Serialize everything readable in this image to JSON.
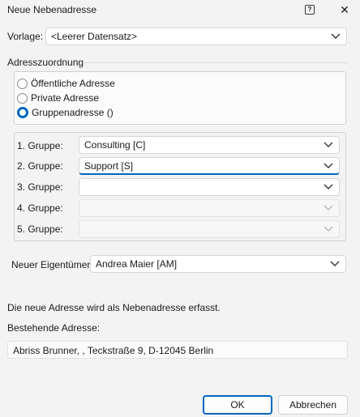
{
  "window": {
    "title": "Neue Nebenadresse",
    "help_glyph": "?",
    "close_glyph": "✕"
  },
  "template": {
    "label": "Vorlage:",
    "value": "<Leerer Datensatz>"
  },
  "assignment": {
    "title": "Adresszuordnung",
    "options": [
      {
        "label": "Öffentliche Adresse",
        "checked": false
      },
      {
        "label": "Private Adresse",
        "checked": false
      },
      {
        "label": "Gruppenadresse ()",
        "checked": true
      }
    ]
  },
  "groups": [
    {
      "label": "1. Gruppe:",
      "value": "Consulting [C]",
      "enabled": true
    },
    {
      "label": "2. Gruppe:",
      "value": "Support [S]",
      "enabled": true
    },
    {
      "label": "3. Gruppe:",
      "value": "",
      "enabled": true
    },
    {
      "label": "4. Gruppe:",
      "value": "",
      "enabled": false
    },
    {
      "label": "5. Gruppe:",
      "value": "",
      "enabled": false
    }
  ],
  "owner": {
    "label": "Neuer Eigentümer:",
    "value": "Andrea Maier [AM]"
  },
  "info_text": "Die neue Adresse wird als Nebenadresse erfasst.",
  "existing": {
    "label": "Bestehende Adresse:",
    "value": "Abriss Brunner,  , Teckstraße 9, D-12045 Berlin"
  },
  "buttons": {
    "ok": "OK",
    "cancel": "Abbrechen"
  },
  "colors": {
    "accent": "#0067c0",
    "background": "#f3f3f3"
  }
}
